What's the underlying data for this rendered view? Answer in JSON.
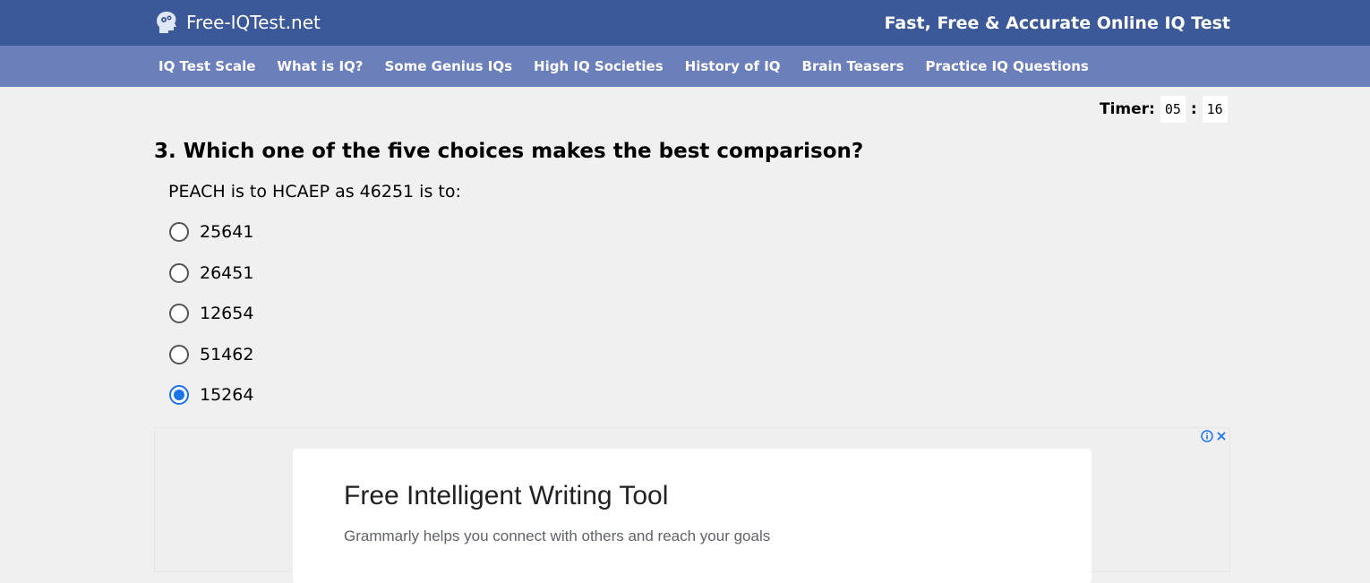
{
  "header": {
    "site_name": "Free-IQTest.net",
    "tagline": "Fast, Free & Accurate Online IQ Test",
    "logo_icon": "brain-head-icon",
    "bg_color": "#3b5998"
  },
  "nav": {
    "bg_color": "#6b7fbb",
    "items": [
      {
        "label": "IQ Test Scale"
      },
      {
        "label": "What is IQ?"
      },
      {
        "label": "Some Genius IQs"
      },
      {
        "label": "High IQ Societies"
      },
      {
        "label": "History of IQ"
      },
      {
        "label": "Brain Teasers"
      },
      {
        "label": "Practice IQ Questions"
      }
    ]
  },
  "timer": {
    "label": "Timer:",
    "minutes": "05",
    "separator": ":",
    "seconds": "16"
  },
  "question": {
    "title": "3. Which one of the five choices makes the best comparison?",
    "prompt": "PEACH is to HCAEP as 46251 is to:",
    "options": [
      {
        "label": "25641",
        "selected": false
      },
      {
        "label": "26451",
        "selected": false
      },
      {
        "label": "12654",
        "selected": false
      },
      {
        "label": "51462",
        "selected": false
      },
      {
        "label": "15264",
        "selected": true
      }
    ],
    "accent_color": "#1a73e8"
  },
  "ad": {
    "info_icon": "info-icon",
    "close_icon": "close-icon",
    "title": "Free Intelligent Writing Tool",
    "description": "Grammarly helps you connect with others and reach your goals"
  }
}
